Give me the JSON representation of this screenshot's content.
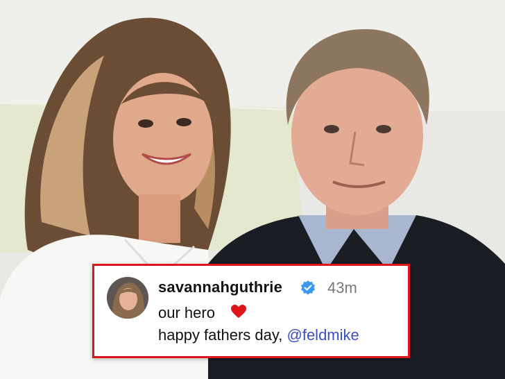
{
  "post": {
    "username": "savannahguthrie",
    "time_ago": "43m",
    "line1": "our hero",
    "line2_prefix": "happy fathers day, ",
    "mention": "@feldmike"
  },
  "icons": {
    "verified": "verified-badge-icon",
    "heart": "red-heart-icon"
  },
  "colors": {
    "card_border": "#e0141b",
    "mention": "#3b4ec4",
    "verified_badge": "#3897f0",
    "heart": "#e0141b"
  }
}
